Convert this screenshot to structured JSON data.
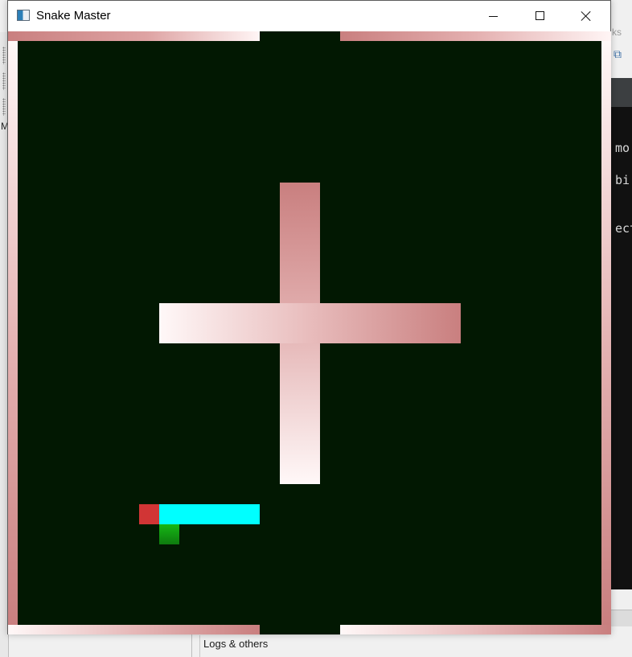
{
  "window": {
    "title": "Snake Master",
    "controls": {
      "minimize": "minimize-icon",
      "maximize": "maximize-icon",
      "close": "close-icon"
    }
  },
  "game": {
    "background_color": "#021802",
    "wall_color_dark": "#c97f7f",
    "wall_color_light": "#fff8f8",
    "snake_head_color": "#d13535",
    "snake_body_color": "#00ffff",
    "food_color": "#16b816"
  },
  "background": {
    "right_tab_fragment": "ks",
    "terminal_lines": [
      "mo",
      "bi",
      "ect"
    ],
    "bottom_panel_label": "Logs & others",
    "left_tab_fragment": "M"
  }
}
